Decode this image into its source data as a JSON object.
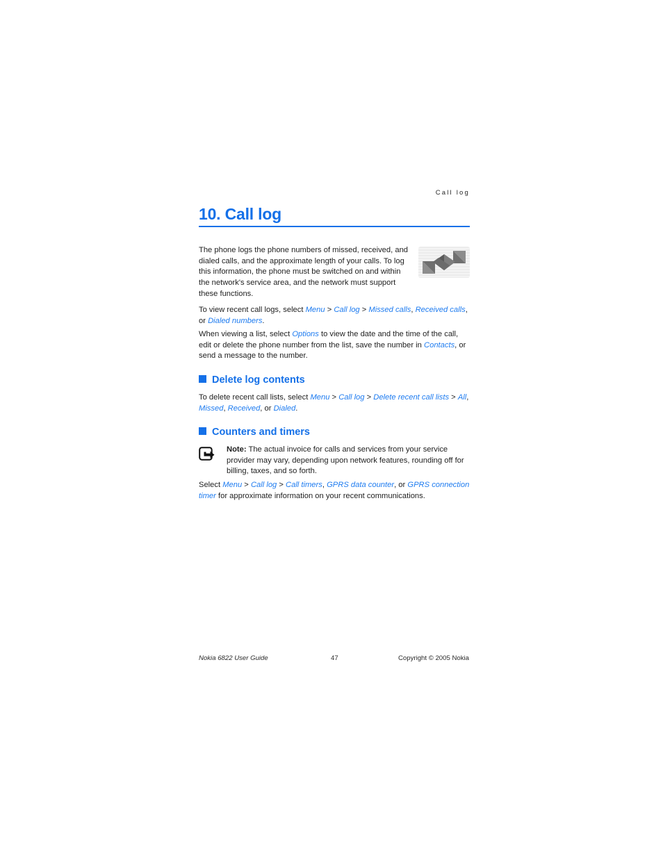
{
  "running_header": "Call log",
  "chapter": {
    "title": "10. Call log",
    "rule_color": "#1470e8"
  },
  "colors": {
    "accent_blue": "#1470e8",
    "link_blue": "#1f7cf0",
    "body_text": "#1f1f1f"
  },
  "icons": {
    "call_log_icon": "call-log-arrows-icon",
    "note_icon": "note-pointer-icon",
    "bullet": "blue-square-bullet"
  },
  "intro": {
    "text": "The phone logs the phone numbers of missed, received, and dialed calls, and the approximate length of your calls. To log this information, the phone must be switched on and within the network's service area, and the network must support these functions."
  },
  "para_view": {
    "lead": "To view recent call logs, select ",
    "links": [
      "Menu",
      "Call log",
      "Missed calls",
      "Received calls",
      "Dialed numbers"
    ],
    "sep_gt": " > ",
    "sep_comma": ", ",
    "sep_or": ", or ",
    "end": "."
  },
  "para_options": {
    "part1": "When viewing a list, select ",
    "link1": "Options",
    "part2": " to view the date and the time of the call, edit or delete the phone number from the list, save the number in ",
    "link2": "Contacts",
    "part3": ", or send a message to the number."
  },
  "section_delete": {
    "heading": "Delete log contents",
    "para": {
      "lead": "To delete recent call lists, select ",
      "links": [
        "Menu",
        "Call log",
        "Delete recent call lists",
        "All",
        "Missed",
        "Received",
        "Dialed"
      ],
      "sep_gt": " > ",
      "sep_comma": ", ",
      "sep_or": ", or ",
      "end": "."
    }
  },
  "section_counters": {
    "heading": "Counters and timers",
    "note": {
      "label": "Note:",
      "text": " The actual invoice for calls and services from your service provider may vary, depending upon network features, rounding off for billing, taxes, and so forth."
    },
    "para": {
      "lead": "Select ",
      "links": [
        "Menu",
        "Call log",
        "Call timers",
        "GPRS data counter",
        "GPRS connection timer"
      ],
      "sep_gt": " > ",
      "sep_comma": ", ",
      "sep_or": ", or ",
      "tail": " for approximate information on your recent communications."
    }
  },
  "footer": {
    "left": "Nokia 6822 User Guide",
    "page_number": "47",
    "right": "Copyright © 2005 Nokia"
  }
}
